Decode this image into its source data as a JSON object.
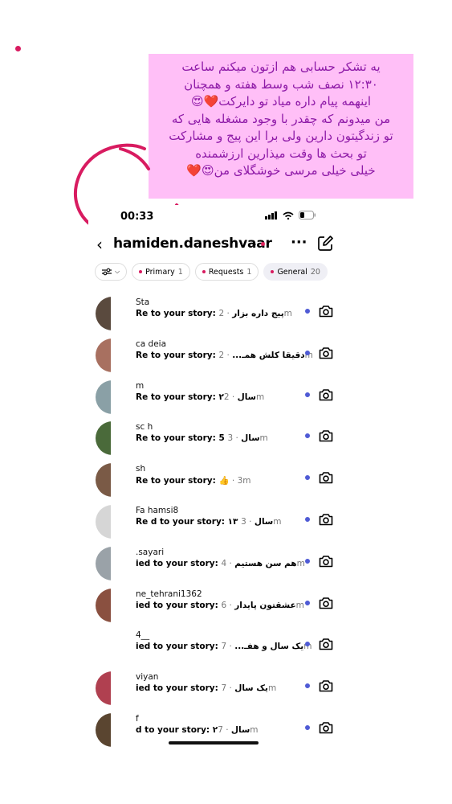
{
  "note": {
    "lines": [
      "یه تشکر حسابی هم ازتون میکنم ساعت",
      "۱۲:۳۰ نصف شب وسط هفته و همچنان",
      "اینهمه پیام داره میاد تو دایرکت❤️😍",
      "من میدونم که چقدر با وجود مشغله هایی که",
      "تو زندگیتون دارین ولی برا این پیج و مشارکت",
      "تو بحث ها وقت میذارین ارزشمنده",
      "خیلی خیلی مرسی خوشگلای من😍❤️"
    ]
  },
  "status": {
    "time": "00:33"
  },
  "header": {
    "username": "hamiden.daneshvaar",
    "chevron": "⌄",
    "back": "‹",
    "more": "···"
  },
  "filters": [
    {
      "label": "",
      "icon": "sliders-icon",
      "active": false
    },
    {
      "label": "Primary",
      "count": "1",
      "active": false
    },
    {
      "label": "Requests",
      "count": "1",
      "active": false
    },
    {
      "label": "General",
      "count": "20",
      "active": true
    }
  ],
  "colors": {
    "accent_pink": "#d81b60",
    "note_bg": "#ffbff7",
    "note_text": "#8e1aa7",
    "unread_dot": "#4f5bd5"
  },
  "threads": [
    {
      "name": "Sta",
      "message": "Re      to your story: پیج داره بزار",
      "time": " · 2m",
      "avatar": "#5a4a3e"
    },
    {
      "name": "ca        deia",
      "message": "Re      to your story: دقیقا کلش همـ...",
      "time": " · 2m",
      "avatar": "#a87060"
    },
    {
      "name": "m",
      "message": "Re      to your story: ۲سال",
      "time": " · 2m",
      "avatar": "#8aa0a6"
    },
    {
      "name": "sc          h",
      "message": "Re      to your story: 5 سال",
      "time": " · 3m",
      "avatar": "#4a6a3a"
    },
    {
      "name": "sh",
      "message": "Re      to your story: 👍",
      "time": " · 3m",
      "avatar": "#7a5a46"
    },
    {
      "name": "Fa        hamsi8",
      "message": "Re      d to your story: ۱۳ سال",
      "time": " · 3m",
      "avatar": "#d6d6d6"
    },
    {
      "name": "       .sayari",
      "message": "      ied to your story: هم سن هستیم",
      "time": " · 4m",
      "avatar": "#9aa2a8"
    },
    {
      "name": "       ne_tehrani1362",
      "message": "      ied to your story: عشقتون پایدار",
      "time": " · 6m",
      "avatar": "#8a5040"
    },
    {
      "name": "       4__",
      "message": "      ied to your story: یک سال و هفـ...",
      "time": " · 7m",
      "avatar": "#ffffff"
    },
    {
      "name": "       viyan",
      "message": "      ied to your story: یک سال",
      "time": " · 7m",
      "avatar": "#b04050"
    },
    {
      "name": "f",
      "message": "      d to your story: ۲سال",
      "time": " · 7m",
      "avatar": "#5a4530"
    }
  ]
}
